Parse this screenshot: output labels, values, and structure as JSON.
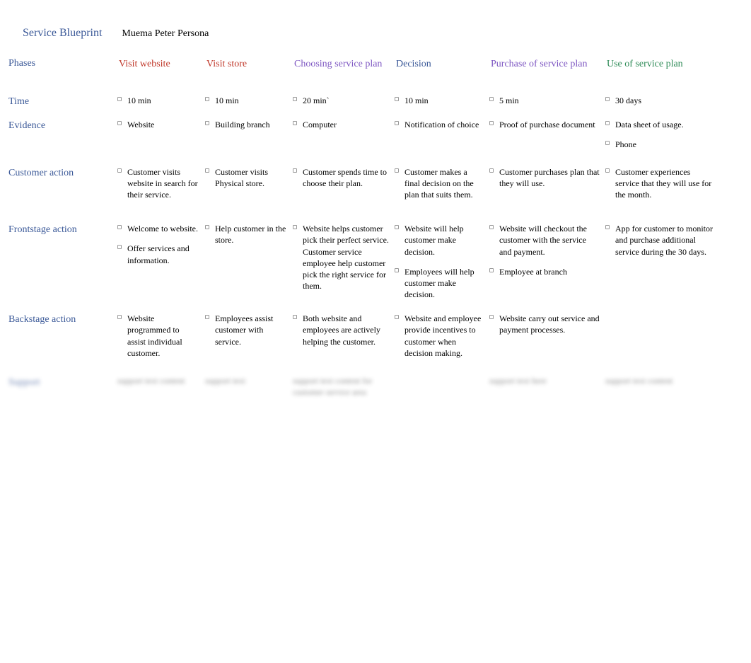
{
  "doc": {
    "title": "Service Blueprint",
    "subtitle": "Muema Peter Persona"
  },
  "rowLabels": {
    "phases": "Phases",
    "time": "Time",
    "evidence": "Evidence",
    "customer": "Customer action",
    "front": "Frontstage action",
    "back": "Backstage action",
    "blurred": "Support"
  },
  "phases": [
    {
      "label": "Visit website",
      "colorClass": "c-red"
    },
    {
      "label": "Visit store",
      "colorClass": "c-red"
    },
    {
      "label": "Choosing service plan",
      "colorClass": "c-purple"
    },
    {
      "label": "Decision",
      "colorClass": "c-blue"
    },
    {
      "label": "Purchase of service plan",
      "colorClass": "c-purple"
    },
    {
      "label": "Use of service plan",
      "colorClass": "c-green"
    }
  ],
  "time": [
    "10 min",
    "10 min",
    "20 min`",
    "10 min",
    "5 min",
    "30 days"
  ],
  "evidence": [
    [
      "Website"
    ],
    [
      "Building branch"
    ],
    [
      "Computer"
    ],
    [
      "Notification of choice"
    ],
    [
      "Proof of purchase document"
    ],
    [
      "Data sheet of usage.",
      "Phone"
    ]
  ],
  "customer": [
    [
      "Customer visits website in search for their service."
    ],
    [
      "Customer visits Physical store."
    ],
    [
      "Customer spends time to choose their plan."
    ],
    [
      "Customer makes a final decision on the plan that suits them."
    ],
    [
      "Customer purchases plan that they will use."
    ],
    [
      "Customer experiences service that they will use for the month."
    ]
  ],
  "front": [
    [
      "Welcome to website.",
      "Offer services and information."
    ],
    [
      "Help customer in the store."
    ],
    [
      "Website helps customer pick their perfect service. Customer service employee help customer pick the right service for them."
    ],
    [
      "Website will help customer make decision.",
      "Employees will help customer make decision."
    ],
    [
      "Website will checkout the customer with the service and payment.",
      "Employee at branch"
    ],
    [
      "App for customer to monitor and purchase additional service during the 30 days."
    ]
  ],
  "back": [
    [
      "Website programmed to assist individual customer."
    ],
    [
      "Employees assist customer with service."
    ],
    [
      "Both website and employees are actively helping the customer."
    ],
    [
      "Website and employee provide incentives to customer when decision making."
    ],
    [
      "Website carry out service and payment processes."
    ],
    [
      ""
    ]
  ],
  "blurredRow": [
    "support text content",
    "support text",
    "support text content for customer service area",
    "",
    "support text here",
    "support text content"
  ]
}
